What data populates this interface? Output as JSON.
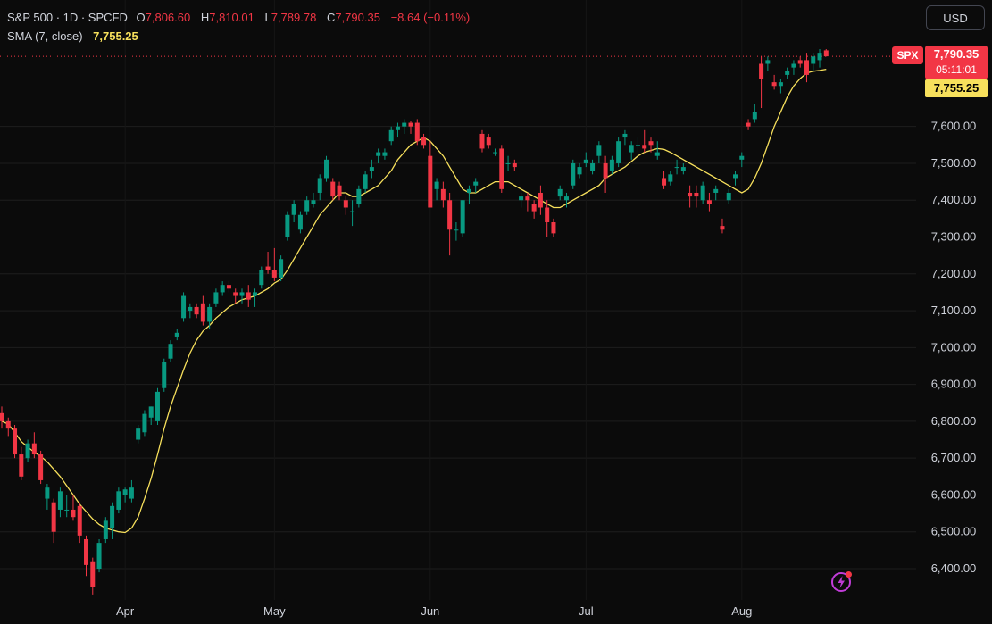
{
  "header": {
    "symbol": "S&P 500 · 1D · SPCFD",
    "open_label": "O",
    "open": "7,806.60",
    "high_label": "H",
    "high": "7,810.01",
    "low_label": "L",
    "low": "7,789.78",
    "close_label": "C",
    "close": "7,790.35",
    "change": "−8.64 (−0.11%)",
    "sma_label": "SMA (7, close)",
    "sma_value": "7,755.25"
  },
  "currency_button": "USD",
  "price_tag": {
    "symbol": "SPX",
    "price": "7,790.35",
    "countdown": "05:11:01"
  },
  "sma_tag": "7,755.25",
  "icons": {
    "bolt": "lightning-bolt-icon"
  },
  "colors": {
    "up": "#089981",
    "down": "#f23645",
    "sma": "#f7e05c",
    "grid": "#1e1e1e",
    "background": "#0b0b0b"
  },
  "chart_data": {
    "type": "candlestick",
    "y_axis": {
      "range": [
        6340,
        7830
      ],
      "ticks": [
        "6,400.00",
        "6,500.00",
        "6,600.00",
        "6,700.00",
        "6,800.00",
        "6,900.00",
        "7,000.00",
        "7,100.00",
        "7,200.00",
        "7,300.00",
        "7,400.00",
        "7,500.00",
        "7,600.00"
      ],
      "tick_values": [
        6400,
        6500,
        6600,
        6700,
        6800,
        6900,
        7000,
        7100,
        7200,
        7300,
        7400,
        7500,
        7600
      ]
    },
    "x_axis": {
      "labels": [
        "Apr",
        "May",
        "Jun",
        "Jul",
        "Aug"
      ],
      "label_index": [
        19,
        42,
        66,
        90,
        114
      ]
    },
    "grid": true,
    "last_price_line": 7790.35,
    "candles": [
      [
        6822,
        6840,
        6780,
        6800
      ],
      [
        6800,
        6810,
        6760,
        6780
      ],
      [
        6780,
        6790,
        6700,
        6710
      ],
      [
        6710,
        6730,
        6640,
        6650
      ],
      [
        6700,
        6750,
        6690,
        6740
      ],
      [
        6740,
        6770,
        6700,
        6710
      ],
      [
        6710,
        6720,
        6630,
        6640
      ],
      [
        6590,
        6630,
        6560,
        6620
      ],
      [
        6580,
        6590,
        6470,
        6500
      ],
      [
        6560,
        6620,
        6540,
        6610
      ],
      [
        6560,
        6600,
        6540,
        6560
      ],
      [
        6560,
        6600,
        6530,
        6540
      ],
      [
        6570,
        6580,
        6470,
        6490
      ],
      [
        6480,
        6490,
        6380,
        6410
      ],
      [
        6420,
        6430,
        6330,
        6350
      ],
      [
        6400,
        6480,
        6390,
        6470
      ],
      [
        6480,
        6540,
        6470,
        6530
      ],
      [
        6510,
        6580,
        6480,
        6570
      ],
      [
        6560,
        6620,
        6550,
        6610
      ],
      [
        6600,
        6620,
        6580,
        6615
      ],
      [
        6590,
        6640,
        6580,
        6620
      ],
      [
        6750,
        6790,
        6740,
        6780
      ],
      [
        6770,
        6830,
        6760,
        6820
      ],
      [
        6810,
        6840,
        6790,
        6840
      ],
      [
        6800,
        6890,
        6790,
        6880
      ],
      [
        6890,
        6970,
        6880,
        6960
      ],
      [
        6970,
        7020,
        6960,
        7010
      ],
      [
        7030,
        7050,
        7020,
        7040
      ],
      [
        7080,
        7150,
        7070,
        7140
      ],
      [
        7100,
        7120,
        7080,
        7110
      ],
      [
        7110,
        7120,
        7080,
        7090
      ],
      [
        7120,
        7140,
        7060,
        7070
      ],
      [
        7070,
        7120,
        7050,
        7110
      ],
      [
        7120,
        7160,
        7110,
        7150
      ],
      [
        7150,
        7180,
        7140,
        7170
      ],
      [
        7170,
        7180,
        7150,
        7160
      ],
      [
        7150,
        7160,
        7120,
        7140
      ],
      [
        7140,
        7160,
        7120,
        7150
      ],
      [
        7150,
        7170,
        7110,
        7130
      ],
      [
        7140,
        7160,
        7110,
        7150
      ],
      [
        7170,
        7220,
        7160,
        7210
      ],
      [
        7220,
        7260,
        7200,
        7210
      ],
      [
        7210,
        7270,
        7180,
        7190
      ],
      [
        7190,
        7250,
        7180,
        7240
      ],
      [
        7300,
        7370,
        7290,
        7360
      ],
      [
        7360,
        7400,
        7340,
        7390
      ],
      [
        7320,
        7370,
        7310,
        7360
      ],
      [
        7370,
        7410,
        7360,
        7400
      ],
      [
        7390,
        7420,
        7380,
        7400
      ],
      [
        7420,
        7470,
        7400,
        7460
      ],
      [
        7460,
        7520,
        7450,
        7510
      ],
      [
        7450,
        7460,
        7400,
        7410
      ],
      [
        7440,
        7450,
        7400,
        7410
      ],
      [
        7400,
        7410,
        7360,
        7380
      ],
      [
        7370,
        7400,
        7330,
        7370
      ],
      [
        7390,
        7440,
        7380,
        7430
      ],
      [
        7430,
        7480,
        7420,
        7470
      ],
      [
        7480,
        7510,
        7460,
        7490
      ],
      [
        7520,
        7540,
        7500,
        7530
      ],
      [
        7520,
        7540,
        7510,
        7530
      ],
      [
        7560,
        7600,
        7550,
        7590
      ],
      [
        7590,
        7610,
        7570,
        7600
      ],
      [
        7600,
        7620,
        7580,
        7610
      ],
      [
        7610,
        7615,
        7580,
        7600
      ],
      [
        7610,
        7620,
        7550,
        7560
      ],
      [
        7570,
        7580,
        7540,
        7550
      ],
      [
        7520,
        7560,
        7400,
        7380
      ],
      [
        7430,
        7460,
        7400,
        7450
      ],
      [
        7430,
        7450,
        7380,
        7400
      ],
      [
        7400,
        7420,
        7250,
        7320
      ],
      [
        7320,
        7340,
        7290,
        7320
      ],
      [
        7310,
        7400,
        7300,
        7400
      ],
      [
        7420,
        7440,
        7390,
        7430
      ],
      [
        7440,
        7460,
        7420,
        7450
      ],
      [
        7580,
        7590,
        7530,
        7540
      ],
      [
        7570,
        7580,
        7540,
        7550
      ],
      [
        7530,
        7540,
        7520,
        7530
      ],
      [
        7540,
        7550,
        7420,
        7430
      ],
      [
        7500,
        7520,
        7480,
        7500
      ],
      [
        7500,
        7510,
        7480,
        7490
      ],
      [
        7400,
        7420,
        7380,
        7410
      ],
      [
        7410,
        7420,
        7370,
        7400
      ],
      [
        7390,
        7400,
        7350,
        7370
      ],
      [
        7420,
        7440,
        7360,
        7380
      ],
      [
        7380,
        7400,
        7300,
        7340
      ],
      [
        7340,
        7350,
        7300,
        7310
      ],
      [
        7410,
        7440,
        7400,
        7430
      ],
      [
        7400,
        7420,
        7380,
        7410
      ],
      [
        7440,
        7510,
        7430,
        7500
      ],
      [
        7470,
        7500,
        7460,
        7490
      ],
      [
        7500,
        7530,
        7490,
        7510
      ],
      [
        7480,
        7510,
        7470,
        7500
      ],
      [
        7520,
        7560,
        7500,
        7550
      ],
      [
        7500,
        7520,
        7420,
        7460
      ],
      [
        7480,
        7520,
        7470,
        7510
      ],
      [
        7500,
        7570,
        7490,
        7560
      ],
      [
        7570,
        7590,
        7550,
        7580
      ],
      [
        7530,
        7560,
        7510,
        7550
      ],
      [
        7550,
        7570,
        7530,
        7550
      ],
      [
        7550,
        7590,
        7530,
        7540
      ],
      [
        7560,
        7570,
        7530,
        7550
      ],
      [
        7520,
        7560,
        7510,
        7530
      ],
      [
        7460,
        7480,
        7430,
        7440
      ],
      [
        7450,
        7480,
        7440,
        7470
      ],
      [
        7490,
        7510,
        7470,
        7490
      ],
      [
        7480,
        7500,
        7470,
        7490
      ],
      [
        7420,
        7440,
        7380,
        7410
      ],
      [
        7420,
        7440,
        7380,
        7410
      ],
      [
        7400,
        7450,
        7390,
        7440
      ],
      [
        7400,
        7420,
        7370,
        7390
      ],
      [
        7420,
        7440,
        7400,
        7430
      ],
      [
        7330,
        7350,
        7310,
        7320
      ],
      [
        7400,
        7430,
        7390,
        7420
      ],
      [
        7460,
        7480,
        7440,
        7470
      ],
      [
        7510,
        7530,
        7490,
        7520
      ],
      [
        7610,
        7620,
        7590,
        7600
      ],
      [
        7620,
        7660,
        7610,
        7640
      ],
      [
        7770,
        7790,
        7650,
        7730
      ],
      [
        7770,
        7790,
        7750,
        7780
      ],
      [
        7720,
        7740,
        7700,
        7710
      ],
      [
        7710,
        7730,
        7690,
        7720
      ],
      [
        7740,
        7760,
        7730,
        7750
      ],
      [
        7760,
        7780,
        7740,
        7770
      ],
      [
        7780,
        7790,
        7760,
        7770
      ],
      [
        7780,
        7800,
        7720,
        7740
      ],
      [
        7770,
        7800,
        7750,
        7790
      ],
      [
        7780,
        7810,
        7760,
        7800
      ],
      [
        7806.6,
        7810.01,
        7789.78,
        7790.35
      ]
    ],
    "sma_series": [
      6800,
      6792,
      6770,
      6745,
      6730,
      6716,
      6705,
      6690,
      6670,
      6650,
      6625,
      6600,
      6575,
      6555,
      6535,
      6520,
      6510,
      6505,
      6500,
      6498,
      6510,
      6540,
      6590,
      6645,
      6710,
      6780,
      6840,
      6890,
      6940,
      6985,
      7020,
      7045,
      7060,
      7080,
      7095,
      7110,
      7120,
      7130,
      7135,
      7140,
      7150,
      7160,
      7175,
      7185,
      7210,
      7240,
      7270,
      7300,
      7330,
      7360,
      7380,
      7400,
      7420,
      7420,
      7410,
      7410,
      7420,
      7430,
      7440,
      7460,
      7480,
      7510,
      7530,
      7550,
      7560,
      7570,
      7560,
      7540,
      7520,
      7490,
      7460,
      7430,
      7420,
      7420,
      7430,
      7440,
      7450,
      7450,
      7450,
      7440,
      7430,
      7420,
      7410,
      7400,
      7390,
      7380,
      7380,
      7390,
      7400,
      7410,
      7420,
      7430,
      7440,
      7460,
      7470,
      7480,
      7490,
      7505,
      7520,
      7530,
      7535,
      7540,
      7538,
      7530,
      7520,
      7510,
      7500,
      7490,
      7480,
      7470,
      7460,
      7450,
      7440,
      7430,
      7420,
      7430,
      7460,
      7500,
      7550,
      7600,
      7640,
      7680,
      7710,
      7730,
      7745,
      7750,
      7752,
      7755.25
    ]
  }
}
